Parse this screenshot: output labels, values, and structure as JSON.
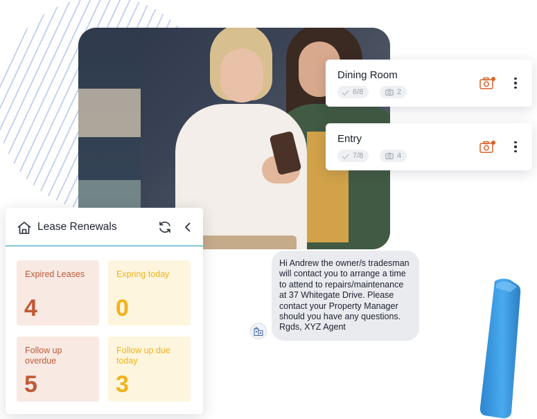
{
  "room_cards": [
    {
      "name": "Dining Room",
      "progress": "6/8",
      "photo_count": "2"
    },
    {
      "name": "Entry",
      "progress": "7/8",
      "photo_count": "4"
    }
  ],
  "lease_renewals": {
    "title": "Lease Renewals",
    "tiles": [
      {
        "label": "Expired Leases",
        "value": "4"
      },
      {
        "label": "Expring today",
        "value": "0"
      },
      {
        "label": "Follow up overdue",
        "value": "5"
      },
      {
        "label": "Follow up due today",
        "value": "3"
      }
    ]
  },
  "sms": {
    "message": "Hi Andrew the owner/s tradesman will contact you to arrange a time to attend to repairs/maintenance at 37 Whitegate Drive. Please contact your Property Manager should you have any questions. Rgds, XYZ Agent"
  },
  "colors": {
    "accent_orange": "#d9622b",
    "tile_red_bg": "#f8e9e3",
    "tile_red_text": "#bf5a36",
    "tile_yellow_bg": "#fdf5dd",
    "tile_yellow_text": "#f2b21b",
    "header_rule": "#84c7d4",
    "device_blue": "#3d9fe0"
  },
  "icons": {
    "camera": "camera-badge-icon",
    "more": "kebab-menu-icon",
    "home": "house-icon",
    "refresh": "refresh-icon",
    "collapse": "chevron-left-icon",
    "check": "check-icon",
    "photo": "camera-outline-icon",
    "agency": "building-icon"
  }
}
